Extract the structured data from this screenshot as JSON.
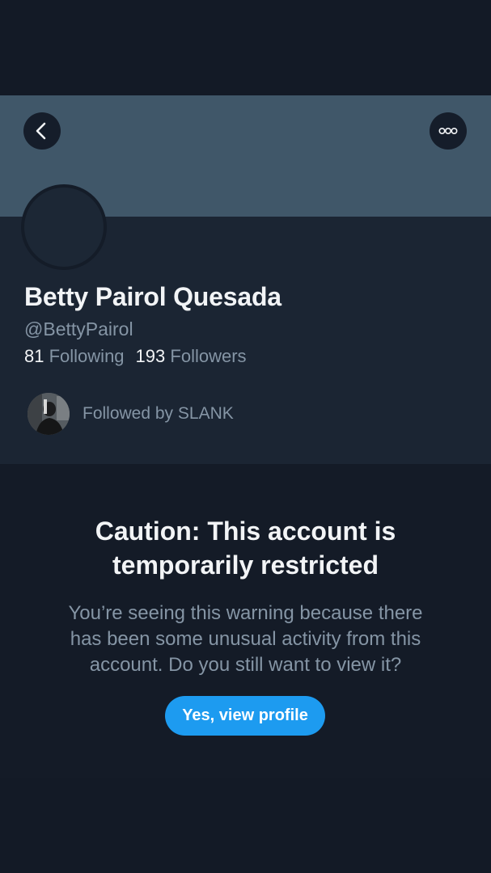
{
  "header": {
    "back_icon": "chevron-left-icon",
    "more_icon": "more-dots-icon"
  },
  "profile": {
    "name": "Betty Pairol Quesada",
    "handle": "@BettyPairol",
    "following_count": "81",
    "following_label": "Following",
    "followers_count": "193",
    "followers_label": "Followers",
    "followed_by": "Followed by SLANK"
  },
  "warning": {
    "title_line1": "Caution: This account is",
    "title_line2": "temporarily restricted",
    "body_line1": "You’re seeing this warning because there",
    "body_line2": "has been some unusual activity from this",
    "body_line3": "account. Do you still want to view it?",
    "button_label": "Yes, view profile"
  },
  "colors": {
    "background": "#131a26",
    "banner": "#405769",
    "profile_bg": "#1b2533",
    "accent": "#1d9bf0",
    "text_primary": "#f2f4f6",
    "text_secondary": "#8595a5"
  }
}
